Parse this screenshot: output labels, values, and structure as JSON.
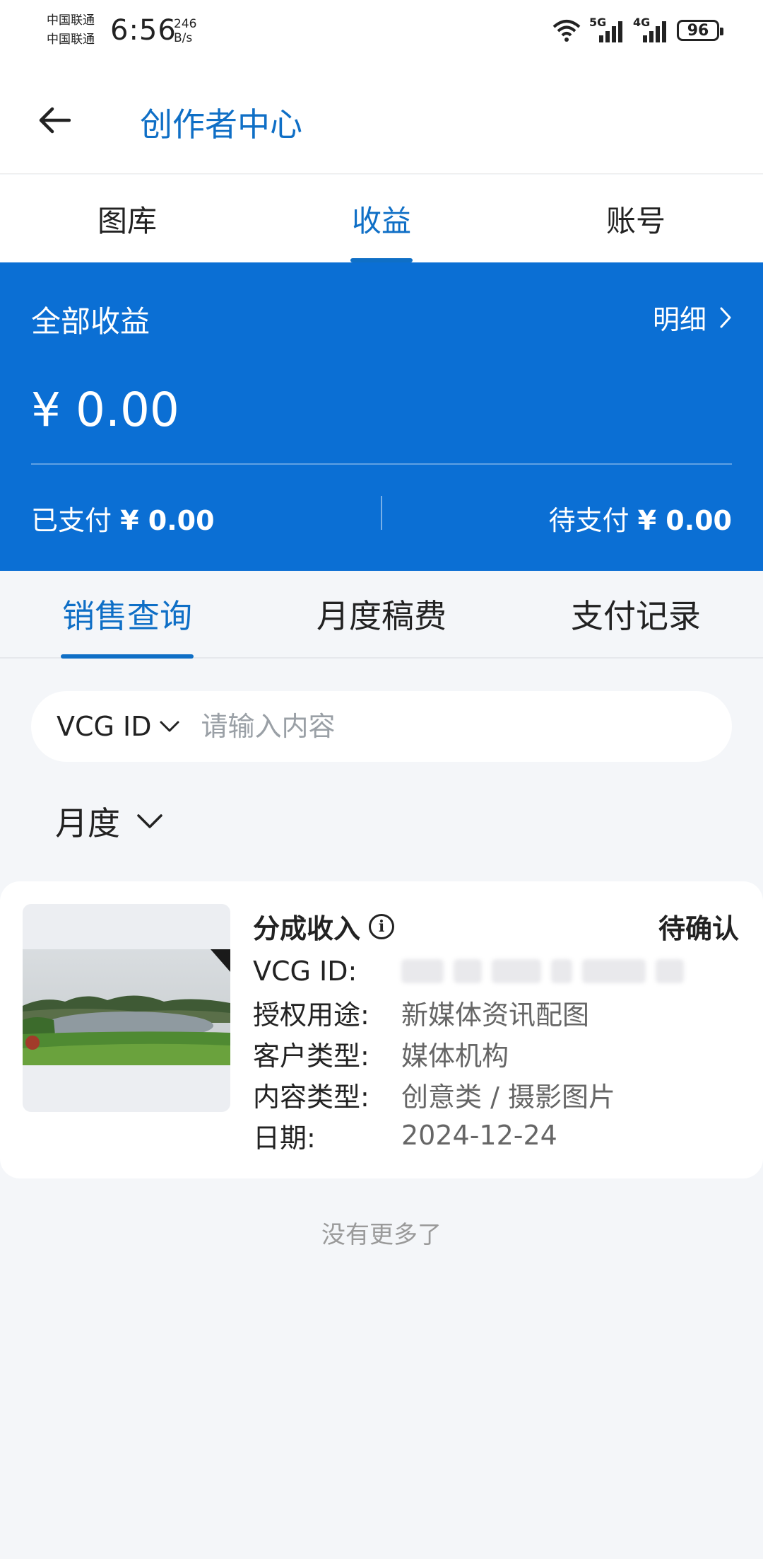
{
  "status_bar": {
    "carrier_1": "中国联通",
    "carrier_2": "中国联通",
    "time": "6:56",
    "net_speed_value": "246",
    "net_speed_unit": "B/s",
    "signal_1_label": "5G",
    "signal_2_label": "4G",
    "battery": "96"
  },
  "header": {
    "back_icon": "arrow-left-icon",
    "title": "创作者中心"
  },
  "top_tabs": [
    {
      "label": "图库",
      "active": false
    },
    {
      "label": "收益",
      "active": true
    },
    {
      "label": "账号",
      "active": false
    }
  ],
  "earnings": {
    "label": "全部收益",
    "detail_label": "明细",
    "total": "¥ 0.00",
    "paid_label": "已支付",
    "paid_value": "¥ 0.00",
    "pending_label": "待支付",
    "pending_value": "¥ 0.00",
    "accent_color": "#0b6fd4"
  },
  "sub_tabs": [
    {
      "label": "销售查询",
      "active": true
    },
    {
      "label": "月度稿费",
      "active": false
    },
    {
      "label": "支付记录",
      "active": false
    }
  ],
  "search": {
    "type_label": "VCG ID",
    "placeholder": "请输入内容"
  },
  "filter": {
    "period_label": "月度"
  },
  "record": {
    "type": "分成收入",
    "status": "待确认",
    "fields": [
      {
        "key": "VCG ID:",
        "value": ""
      },
      {
        "key": "授权用途:",
        "value": "新媒体资讯配图"
      },
      {
        "key": "客户类型:",
        "value": "媒体机构"
      },
      {
        "key": "内容类型:",
        "value": "创意类 / 摄影图片"
      },
      {
        "key": "日期:",
        "value": "2024-12-24"
      }
    ]
  },
  "footer": {
    "no_more": "没有更多了"
  }
}
